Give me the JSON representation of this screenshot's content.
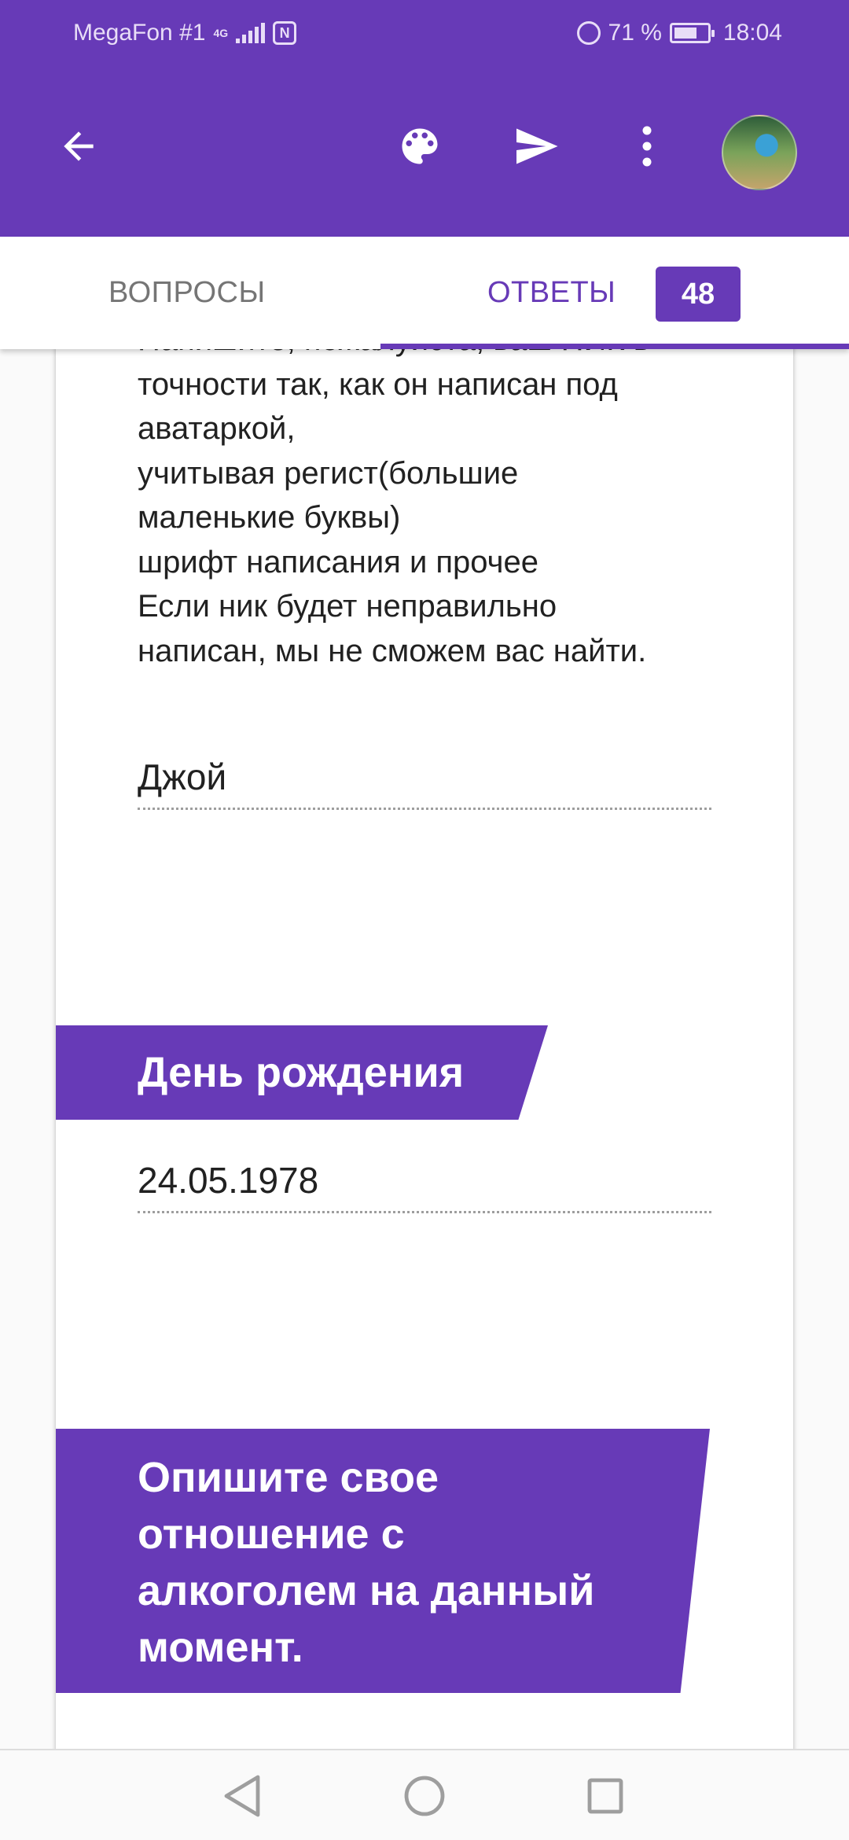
{
  "status_bar": {
    "carrier": "MegaFon #1",
    "network": "4G",
    "nfc": "N",
    "battery_percent": "71 %",
    "battery_level": 0.71,
    "time": "18:04"
  },
  "toolbar": {
    "icons": [
      "arrow-back-icon",
      "palette-icon",
      "send-icon",
      "more-vert-icon",
      "avatar"
    ]
  },
  "tabs": {
    "questions_label": "ВОПРОСЫ",
    "answers_label": "ОТВЕТЫ",
    "answers_count": "48",
    "active": "answers"
  },
  "form": {
    "nick_description": "Напишите, пожалуйста, ваш НИК в\nточности так, как он написан под\nаватаркой,\nучитывая регист(большие\nмаленькие буквы)\nшрифт написания и прочее\nЕсли ник будет неправильно\nнаписан,  мы не сможем вас найти.",
    "nick_answer": "Джой",
    "birthday_title": "День рождения",
    "birthday_answer": "24.05.1978",
    "alcohol_title": "Опишите свое отношение с алкоголем на данный момент."
  },
  "colors": {
    "accent": "#673ab7",
    "text": "#212121",
    "inactive_tab": "#757575"
  },
  "navbar": {
    "icons": [
      "nav-back-icon",
      "nav-home-icon",
      "nav-recents-icon"
    ]
  }
}
